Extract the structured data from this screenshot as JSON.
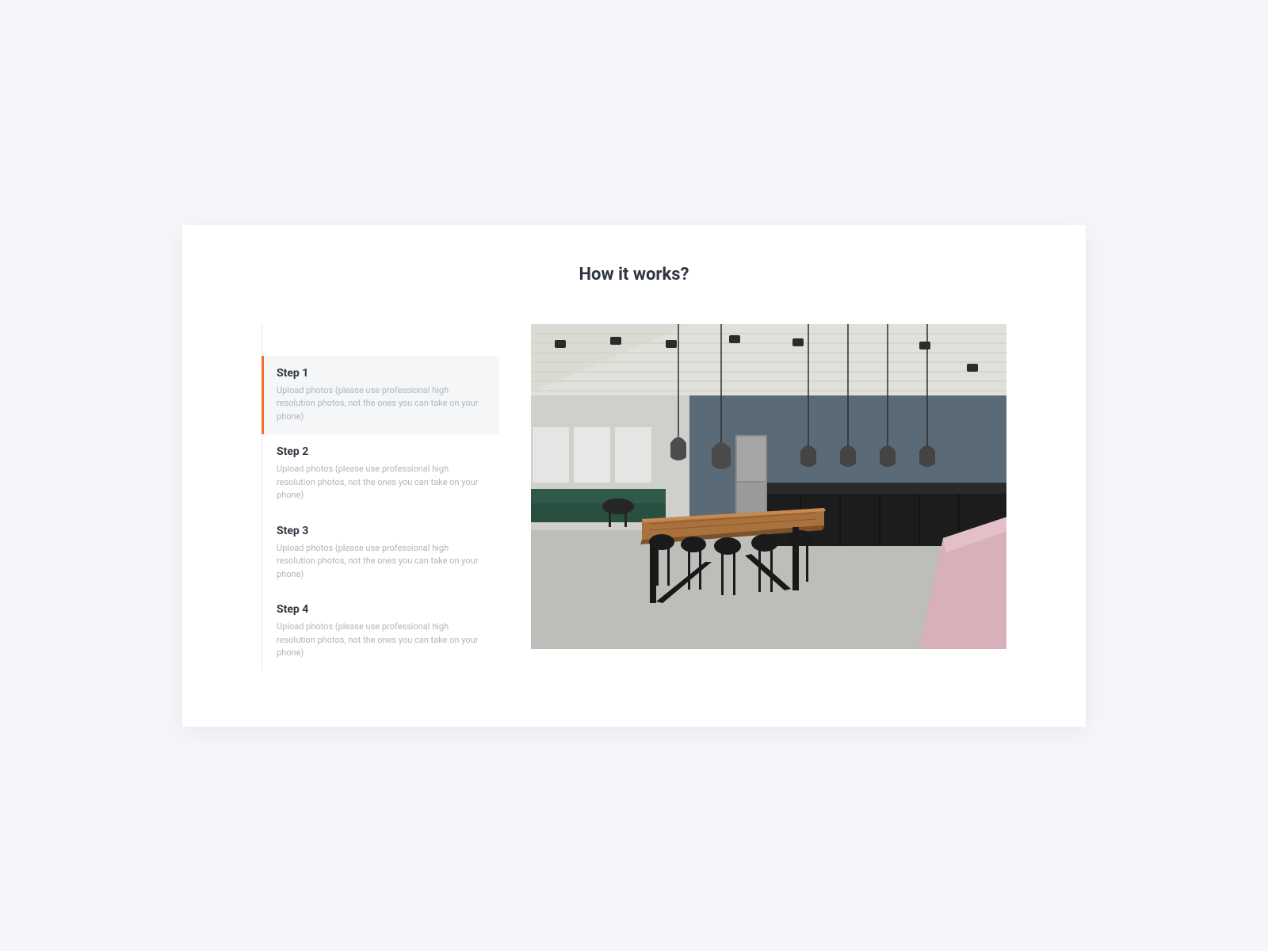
{
  "section": {
    "title": "How it works?"
  },
  "steps": [
    {
      "title": "Step 1",
      "desc": "Upload photos (please use professional high resolution photos, not the ones you can take on your phone)",
      "active": true
    },
    {
      "title": "Step 2",
      "desc": "Upload photos (please use professional high resolution photos, not the ones you can take on your phone)",
      "active": false
    },
    {
      "title": "Step 3",
      "desc": "Upload photos (please use professional high resolution photos, not the ones you can take on your phone)",
      "active": false
    },
    {
      "title": "Step 4",
      "desc": "Upload photos (please use professional high resolution photos, not the ones you can take on your phone)",
      "active": false
    }
  ],
  "colors": {
    "accent": "#f96c2f"
  }
}
